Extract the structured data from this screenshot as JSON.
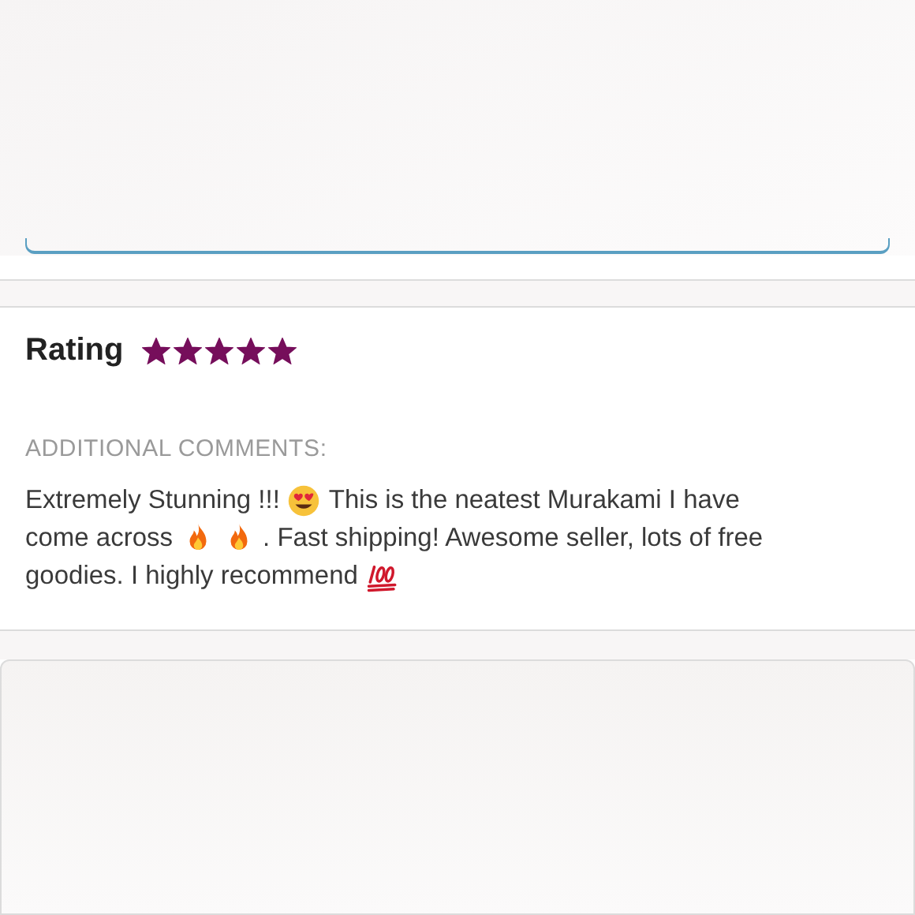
{
  "review": {
    "rating_label": "Rating",
    "stars": 5,
    "comments_label": "ADDITIONAL COMMENTS:",
    "comment_lines": [
      [
        {
          "kind": "text",
          "text": "Extremely Stunning !!!"
        },
        {
          "kind": "heart-eyes"
        },
        {
          "kind": "text",
          "text": "This is the neatest Murakami I have"
        }
      ],
      [
        {
          "kind": "text",
          "text": "come across"
        },
        {
          "kind": "fire"
        },
        {
          "kind": "fire"
        },
        {
          "kind": "text",
          "text": ". Fast shipping! Awesome seller, lots of free"
        }
      ],
      [
        {
          "kind": "text",
          "text": "goodies. I highly recommend"
        },
        {
          "kind": "hundred"
        }
      ]
    ]
  }
}
